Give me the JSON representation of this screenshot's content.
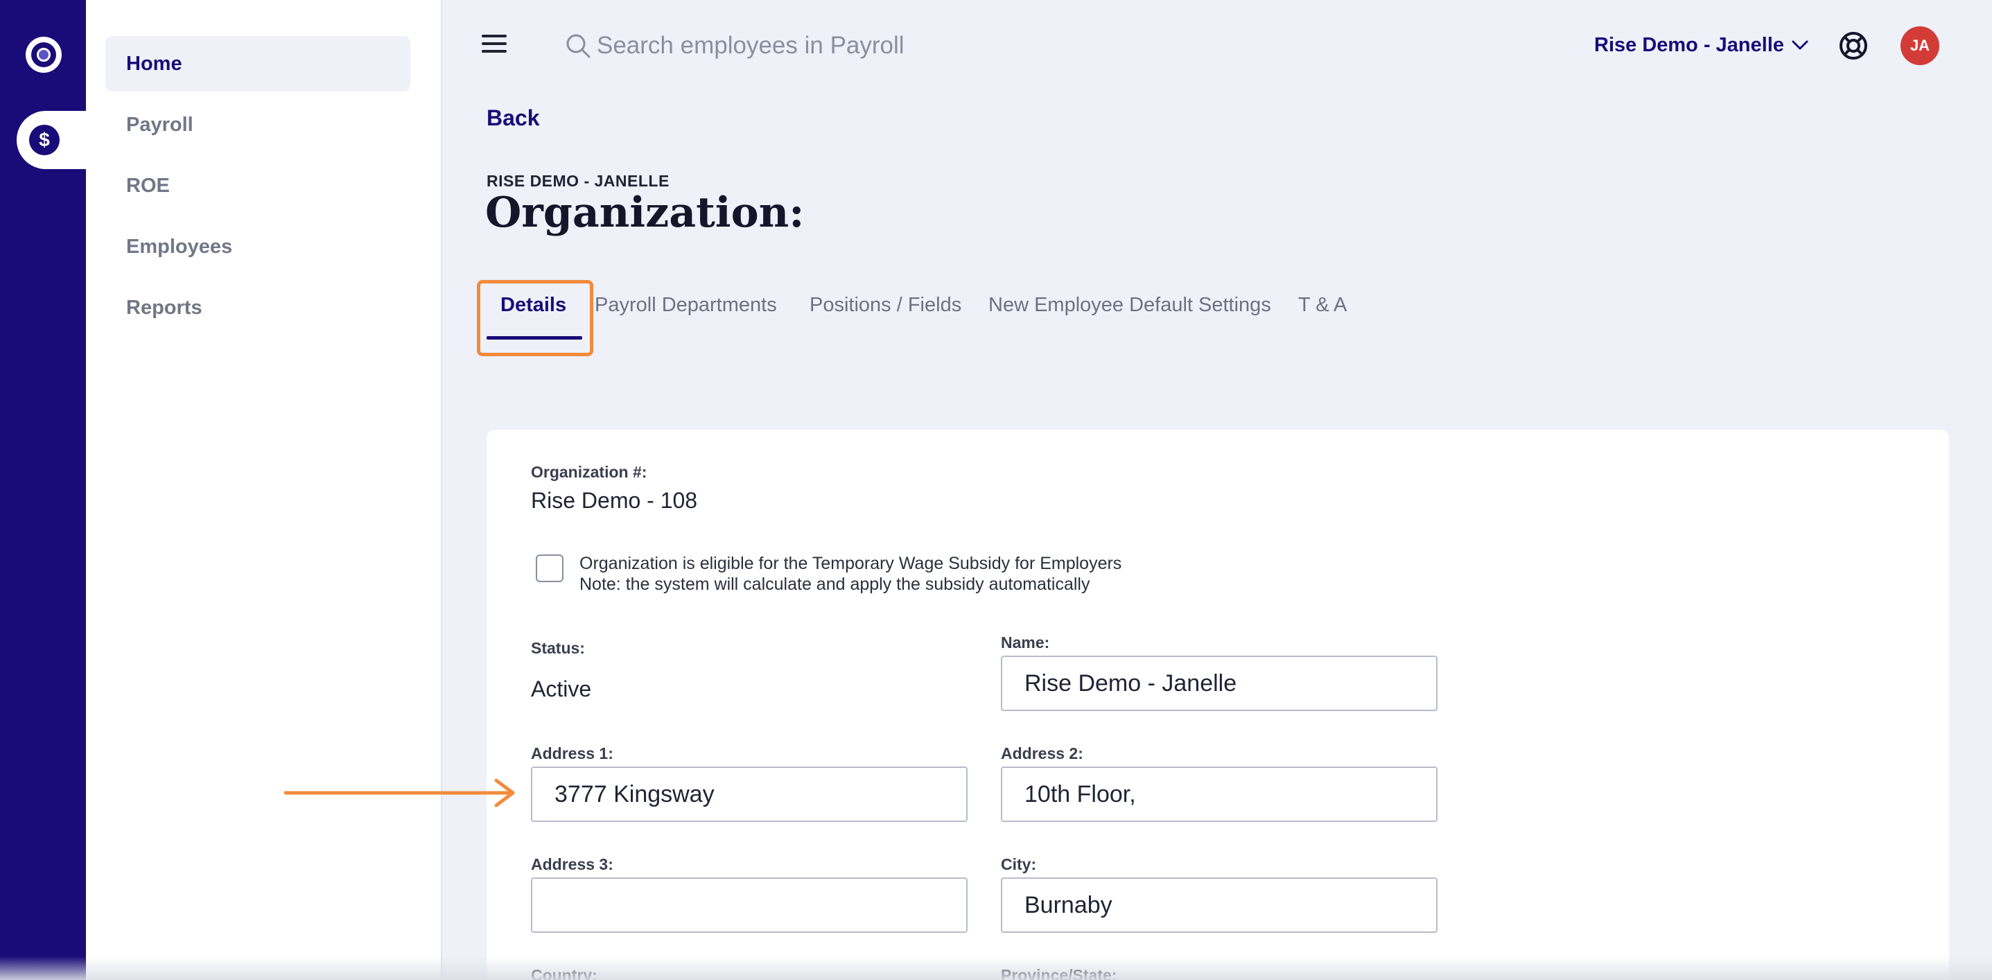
{
  "search": {
    "placeholder": "Search employees in Payroll"
  },
  "sidebar": {
    "items": [
      {
        "label": "Home"
      },
      {
        "label": "Payroll"
      },
      {
        "label": "ROE"
      },
      {
        "label": "Employees"
      },
      {
        "label": "Reports"
      }
    ]
  },
  "topbar": {
    "org_switcher": "Rise Demo - Janelle",
    "avatar_initials": "JA"
  },
  "header": {
    "back_label": "Back",
    "eyebrow": "RISE DEMO - JANELLE",
    "title": "Organization:"
  },
  "tabs": [
    {
      "label": "Details"
    },
    {
      "label": "Payroll Departments"
    },
    {
      "label": "Positions / Fields"
    },
    {
      "label": "New Employee Default Settings"
    },
    {
      "label": "T & A"
    }
  ],
  "details": {
    "org_number_label": "Organization #:",
    "org_number_value": "Rise Demo - 108",
    "subsidy_line1": "Organization is eligible for the Temporary Wage Subsidy for Employers",
    "subsidy_line2": "Note: the system will calculate and apply the subsidy automatically",
    "status_label": "Status:",
    "status_value": "Active",
    "name_label": "Name:",
    "name_value": "Rise Demo - Janelle",
    "address1_label": "Address 1:",
    "address1_value": "3777 Kingsway",
    "address2_label": "Address 2:",
    "address2_value": "10th Floor,",
    "address3_label": "Address 3:",
    "address3_value": "",
    "city_label": "City:",
    "city_value": "Burnaby",
    "country_label": "Country:",
    "province_label": "Province/State:"
  },
  "colors": {
    "brand": "#1a0c78",
    "highlight": "#f28b3c",
    "avatar": "#d33b36"
  }
}
